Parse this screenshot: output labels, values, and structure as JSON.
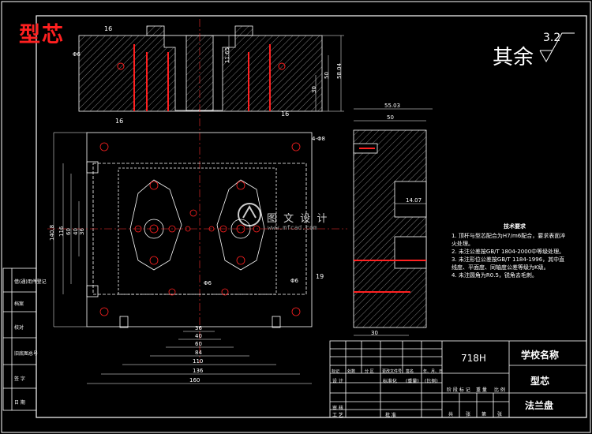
{
  "drawing": {
    "title_tag": "型芯",
    "surface_finish_text": "其余",
    "surface_finish_value": "3.2",
    "watermark_brand": "图 文 设 计",
    "watermark_url": "www.mfcad.com",
    "colors": {
      "line": "#ffffff",
      "accent": "#ff2020",
      "hatch": "#ffffff",
      "center": "#ff3030"
    }
  },
  "dimensions": {
    "side_view_w1": "55.03",
    "side_view_w2": "50",
    "side_view_depth": "14.07",
    "side_view_bottom": "30",
    "top_h1": "11.65",
    "top_h2": "58.04",
    "top_h3": "50",
    "top_h4": "30",
    "top_dia": "Φ6",
    "plan_w1": "36",
    "plan_w2": "40",
    "plan_w3": "60",
    "plan_w4": "84",
    "plan_w5": "110",
    "plan_w6": "136",
    "plan_w7": "160",
    "plan_h1": "116",
    "plan_h2": "140.8",
    "plan_h3": "36",
    "plan_h4": "40",
    "plan_h5": "60",
    "hole1": "4-Φ8",
    "hole2": "Φ6",
    "hole3": "Φ6",
    "num16a": "16",
    "num16b": "16",
    "num16c": "16",
    "num19": "19"
  },
  "tech_requirements": {
    "heading": "技术要求",
    "items": [
      "1. 顶杆与型芯配合为H7/m6配合，要求表面淬火处理。",
      "2. 未注公差按GB/T 1804-2000中等级处理。",
      "3. 未注形位公差按GB/T 1184-1996，其中直线度、平面度、同轴度公差等级为K级。",
      "4. 未注圆角为R0.5，锐角去毛刺。"
    ]
  },
  "left_table": {
    "rows": [
      "借(通)用件登记",
      "旧底图总号",
      "底图总号",
      "签字",
      "日期"
    ],
    "rows_display": [
      "借(通)用件登记",
      "档案",
      "校对",
      "旧底图总号",
      "签 字",
      "日 期"
    ]
  },
  "title_block": {
    "material": "718H",
    "school": "学校名称",
    "part_name": "型芯",
    "drawing_title": "法兰盘",
    "header_labels": [
      "标记",
      "处数",
      "分 区",
      "更改文件号",
      "签名",
      "年、月、日"
    ],
    "row_labels": [
      "设 计",
      "标准化",
      "审 核",
      "工 艺",
      "批 准"
    ],
    "stage_labels": [
      "阶 段 标 记",
      "重 量",
      "比 例"
    ],
    "sheet_labels": [
      "共",
      "张",
      "第",
      "张"
    ],
    "scale_text": "(比例)",
    "weight_text": "(重量)"
  }
}
